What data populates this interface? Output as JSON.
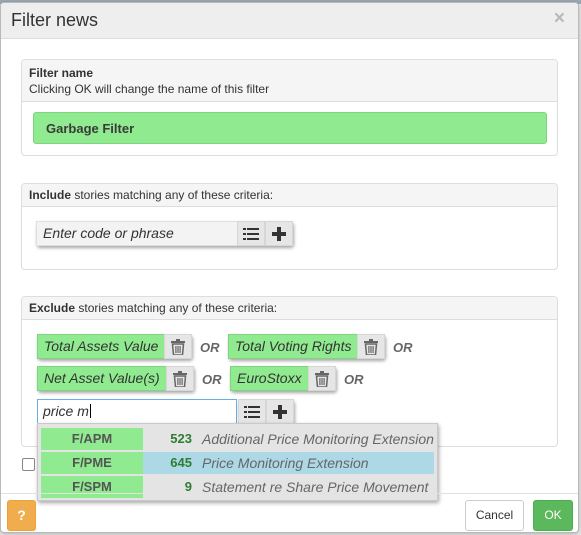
{
  "dialog": {
    "title": "Filter news",
    "close_glyph": "×"
  },
  "filter_name": {
    "heading": "Filter name",
    "hint": "Clicking OK will change the name of this filter",
    "value": "Garbage Filter"
  },
  "include": {
    "heading_bold": "Include",
    "heading_rest": " stories matching any of these criteria:",
    "input_placeholder": "Enter code or phrase"
  },
  "exclude": {
    "heading_bold": "Exclude",
    "heading_rest": " stories matching any of these criteria:",
    "or_label": "OR",
    "chips": [
      "Total Assets Value",
      "Total Voting Rights",
      "Net Asset Value(s)",
      "EuroStoxx"
    ],
    "search_value": "price m"
  },
  "suggestions": [
    {
      "code": "F/APM",
      "count": "523",
      "description": "Additional Price Monitoring Extension"
    },
    {
      "code": "F/PME",
      "count": "645",
      "description": "Price Monitoring Extension"
    },
    {
      "code": "F/SPM",
      "count": "9",
      "description": "Statement re Share Price Movement"
    }
  ],
  "footer": {
    "help_label": "?",
    "cancel_label": "Cancel",
    "ok_label": "OK"
  },
  "icons": {
    "list": "list-icon",
    "add": "plus-icon",
    "delete": "trash-icon"
  },
  "colors": {
    "chip_green": "#90ea90",
    "selected_row": "#add8e6",
    "ok_green": "#5cb85c",
    "help_orange": "#f0ad4e",
    "count_green": "#2e7d32"
  }
}
